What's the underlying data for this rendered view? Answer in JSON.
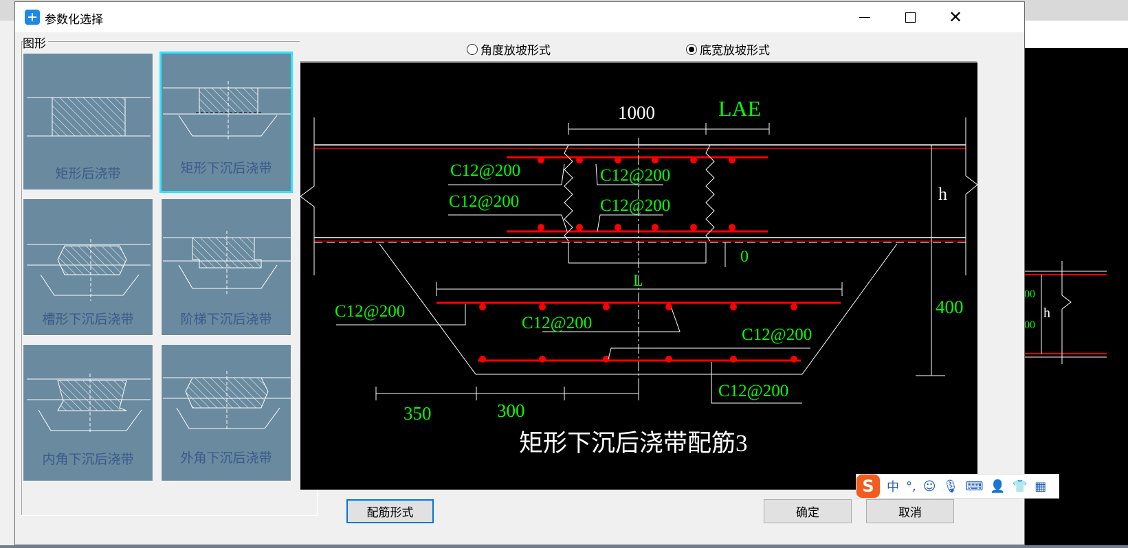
{
  "window": {
    "title": "参数化选择"
  },
  "left_panel": {
    "group_label": "图形",
    "shapes": [
      {
        "label": "矩形后浇带",
        "selected": false
      },
      {
        "label": "矩形下沉后浇带",
        "selected": true
      },
      {
        "label": "槽形下沉后浇带",
        "selected": false
      },
      {
        "label": "阶梯下沉后浇带",
        "selected": false
      },
      {
        "label": "内角下沉后浇带",
        "selected": false
      },
      {
        "label": "外角下沉后浇带",
        "selected": false
      }
    ]
  },
  "slope_options": {
    "angle_label": "角度放坡形式",
    "bottom_width_label": "底宽放坡形式",
    "selected": "底宽放坡形式"
  },
  "drawing": {
    "title": "矩形下沉后浇带配筋3",
    "dim_1000": "1000",
    "dim_lae": "LAE",
    "dim_h_top": "h",
    "dim_zero": "0",
    "dim_l": "L",
    "dim_400": "400",
    "dim_350": "350",
    "dim_300": "300",
    "rebar_labels": [
      "C12@200",
      "C12@200",
      "C12@200",
      "C12@200",
      "C12@200",
      "C12@200",
      "C12@200",
      "C12@200"
    ],
    "bg_label_h": "h",
    "bg_label_a": "00",
    "bg_label_b": "00"
  },
  "buttons": {
    "rebar_form": "配筋形式",
    "ok": "确定",
    "cancel": "取消"
  },
  "ime": {
    "mode": "中",
    "punct": "°,"
  },
  "colors": {
    "canvas_bg": "#000000",
    "thumb_bg": "#6a8aa0",
    "rebar": "#ff0000",
    "dim_green": "#00ff00",
    "line_white": "#ffffff"
  }
}
